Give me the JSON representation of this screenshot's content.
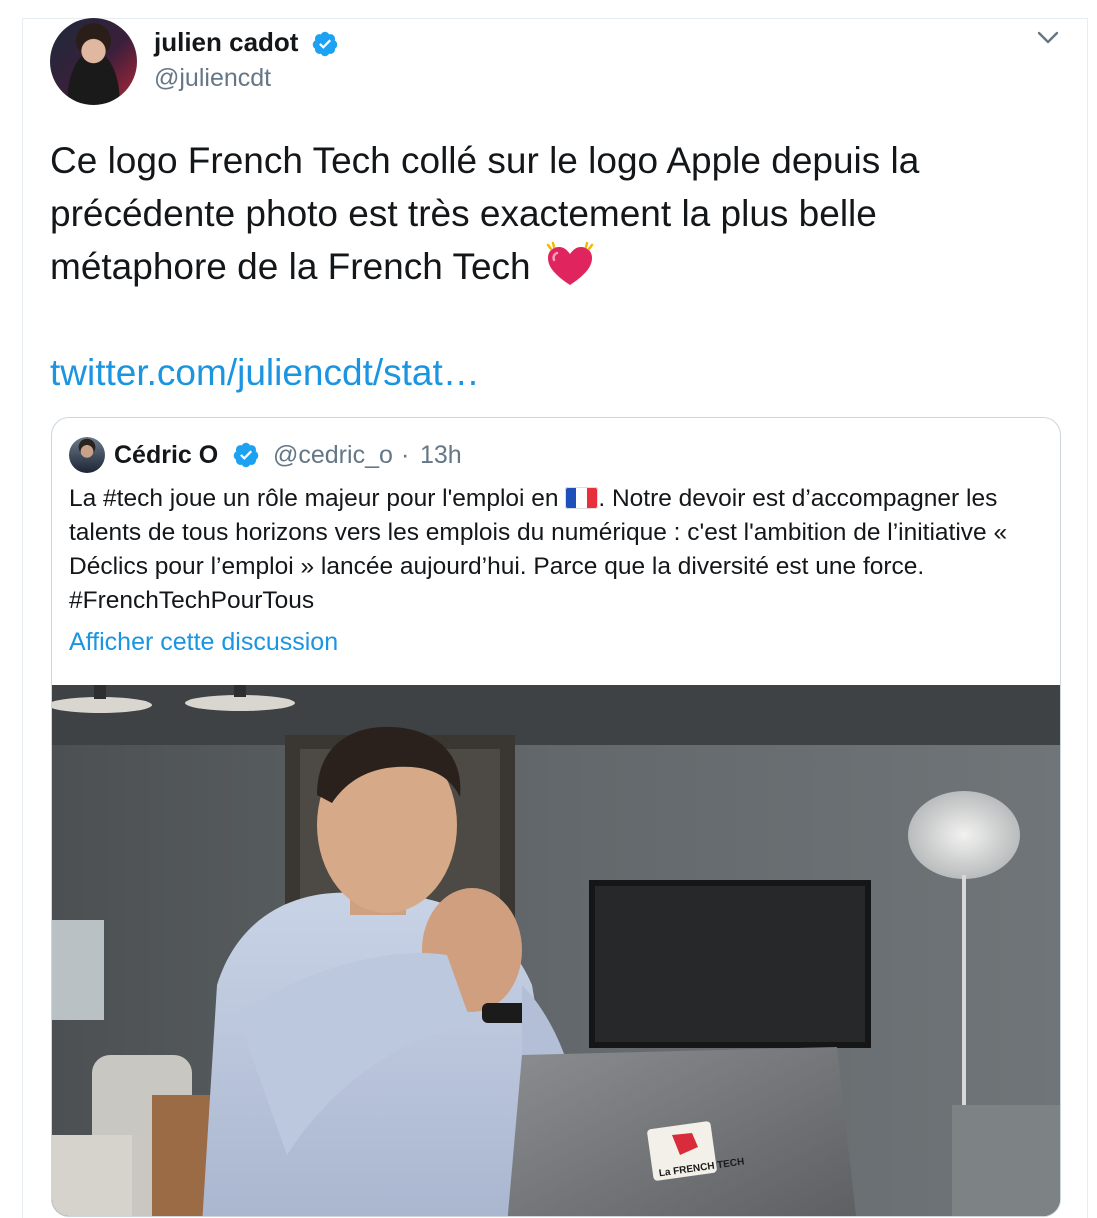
{
  "author": {
    "name": "julien cadot",
    "handle": "@juliencdt"
  },
  "tweet": {
    "text": "Ce logo French Tech collé sur le logo Apple depuis la précédente photo est très exactement la plus belle métaphore de la French Tech",
    "link": "twitter.com/juliencdt/stat…"
  },
  "quoted": {
    "name": "Cédric O",
    "handle": "@cedric_o",
    "separator": "·",
    "time": "13h",
    "text_before_flag": "La #tech joue un rôle majeur pour l'emploi en ",
    "text_after_flag": ". Notre devoir est d’accompagner les talents de tous horizons vers les emplois du numérique : c'est l'ambition de l’initiative « Déclics pour l’emploi » lancée aujourd’hui. Parce que la diversité est une force. #FrenchTechPourTous",
    "show_thread": "Afficher cette discussion",
    "photo_sticker_text": "La FRENCH TECH"
  },
  "colors": {
    "link": "#1b95e0",
    "verified": "#1da1f2",
    "secondary_text": "#657786",
    "heart": "#e0245e"
  },
  "icons": {
    "verified": "verified-badge-icon",
    "menu": "chevron-down-icon",
    "heart": "beating-heart-emoji",
    "flag": "flag-france-emoji"
  }
}
